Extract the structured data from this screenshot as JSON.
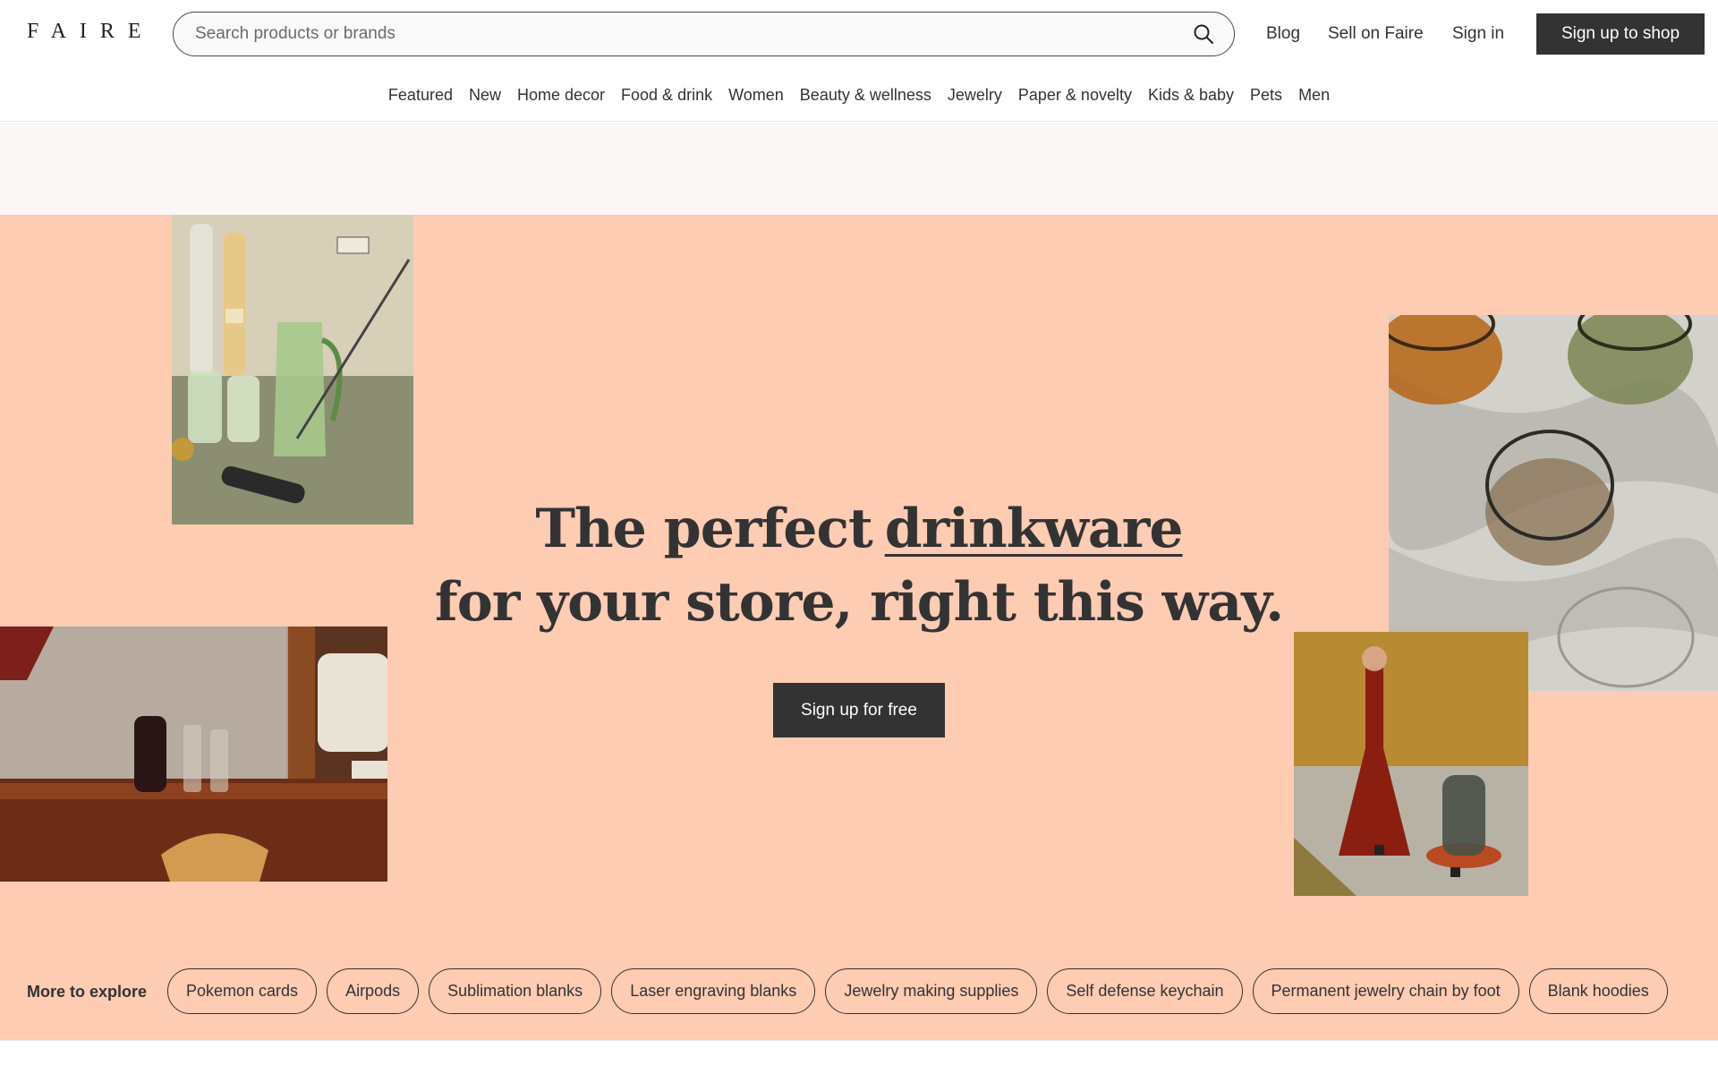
{
  "header": {
    "logo": "FAIRE",
    "search_placeholder": "Search products or brands",
    "links": [
      "Blog",
      "Sell on Faire",
      "Sign in"
    ],
    "signup_label": "Sign up to shop"
  },
  "categories": [
    "Featured",
    "New",
    "Home decor",
    "Food & drink",
    "Women",
    "Beauty & wellness",
    "Jewelry",
    "Paper & novelty",
    "Kids & baby",
    "Pets",
    "Men"
  ],
  "hero": {
    "line1_prefix": "The perfect",
    "highlight_word": "drinkware",
    "line2": "for your store, right this way.",
    "cta_label": "Sign up for free",
    "background": "#fecbb3"
  },
  "explore": {
    "label": "More to explore",
    "chips": [
      "Pokemon cards",
      "Airpods",
      "Sublimation blanks",
      "Laser engraving blanks",
      "Jewelry making supplies",
      "Self defense keychain",
      "Permanent jewelry chain by foot",
      "Blank hoodies"
    ]
  },
  "colors": {
    "primary_button": "#333333",
    "hero_bg": "#fecbb3",
    "band_bg": "#faf7f4"
  }
}
